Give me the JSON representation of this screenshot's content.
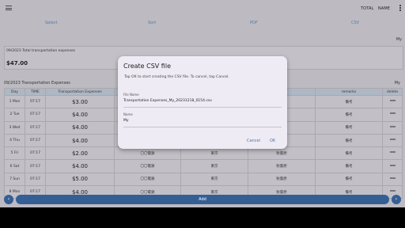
{
  "topbar": {
    "total_label": "TOTAL",
    "name_label": "NAME"
  },
  "tabs": [
    "Select",
    "Sort",
    "PDF",
    "CSV"
  ],
  "header_my": "My",
  "total_section": {
    "label": "09/2023 Total transportation expenses",
    "amount": "$47.00"
  },
  "list": {
    "title": "09/2023 Transportation Expenses",
    "my": "My"
  },
  "table": {
    "headers": [
      "Day",
      "TIME",
      "Transportation Expenses",
      "",
      "",
      "",
      "remarks",
      "delete"
    ],
    "rows": [
      {
        "day": "1 Mon",
        "time": "07:17",
        "amount": "$3.00",
        "c4": "",
        "c5": "",
        "c6": "",
        "remarks": "備考"
      },
      {
        "day": "2 Tue",
        "time": "07:17",
        "amount": "$4.00",
        "c4": "",
        "c5": "",
        "c6": "",
        "remarks": "備考"
      },
      {
        "day": "3 Wed",
        "time": "07:17",
        "amount": "$4.00",
        "c4": "",
        "c5": "",
        "c6": "",
        "remarks": "備考"
      },
      {
        "day": "4 Thu",
        "time": "07:17",
        "amount": "$4.00",
        "c4": "",
        "c5": "",
        "c6": "",
        "remarks": "備考"
      },
      {
        "day": "5 Fri",
        "time": "07:17",
        "amount": "$2.00",
        "c4": "〇〇電鉄",
        "c5": "東京",
        "c6": "秋葉原",
        "remarks": "備考"
      },
      {
        "day": "6 Sat",
        "time": "07:17",
        "amount": "$4.00",
        "c4": "〇〇電鉄",
        "c5": "東京",
        "c6": "秋葉原",
        "remarks": "備考"
      },
      {
        "day": "7 Sun",
        "time": "07:17",
        "amount": "$5.00",
        "c4": "〇〇電鉄",
        "c5": "東京",
        "c6": "秋葉原",
        "remarks": "備考"
      },
      {
        "day": "8 Mon",
        "time": "07:17",
        "amount": "$4.00",
        "c4": "〇〇電鉄",
        "c5": "東京",
        "c6": "秋葉原",
        "remarks": "備考"
      }
    ]
  },
  "bottom": {
    "add_label": "Add",
    "prev_icon": "‹",
    "next_icon": "›"
  },
  "dialog": {
    "title": "Create CSV file",
    "message": "Tap OK to start creating the CSV file. To cancel, tap Cancel.",
    "file_name_label": "File Name",
    "file_name_value": "Transportation Expenses_My_20231218_0154.csv",
    "name_label": "Name",
    "name_value": "My",
    "cancel_label": "Cancel",
    "ok_label": "OK"
  },
  "colors": {
    "accent": "#345f95",
    "link": "#4b7ab3",
    "background": "#bdbbc1"
  }
}
